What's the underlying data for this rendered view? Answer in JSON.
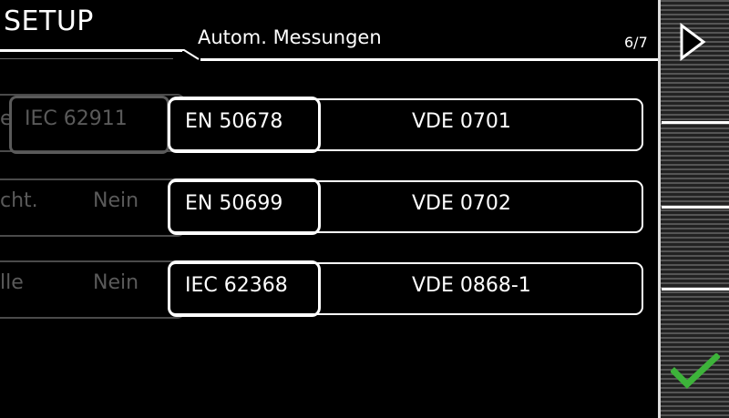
{
  "header": {
    "title": "SETUP",
    "subtitle": "Autom. Messungen",
    "page_indicator": "6/7"
  },
  "background_rows": [
    {
      "label_fragment": "e",
      "value": "IEC 62911"
    },
    {
      "label_fragment": "cht.",
      "value": "Nein"
    },
    {
      "label_fragment": "lle",
      "value": "Nein"
    }
  ],
  "standards": [
    {
      "left": "EN 50678",
      "right": "VDE 0701"
    },
    {
      "left": "EN 50699",
      "right": "VDE 0702"
    },
    {
      "left": "IEC 62368",
      "right": "VDE 0868-1"
    }
  ],
  "icons": {
    "next": "chevron-right-icon",
    "confirm": "checkmark-icon",
    "confirm_color": "#3db33a"
  }
}
